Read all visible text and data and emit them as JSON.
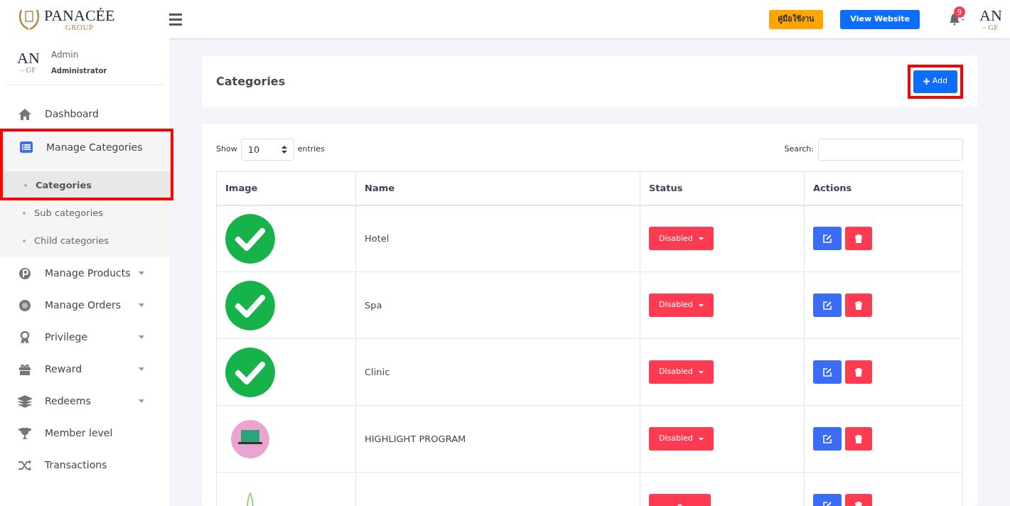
{
  "header": {
    "logo": {
      "name": "PANACÉE",
      "tagline": "GROUP"
    },
    "manual_button": "คู่มือใช้งาน",
    "website_button": "View Website",
    "notifications": "9",
    "avatar_text": "AN",
    "avatar_sub": "– GF"
  },
  "sidebar": {
    "user": {
      "avatar_text": "AN",
      "avatar_sub": "– GF",
      "name": "Admin",
      "role": "Administrator"
    },
    "items": [
      {
        "label": "Dashboard",
        "has_caret": false
      },
      {
        "label": "Manage Categories",
        "has_caret": true,
        "expanded": true,
        "annotated": true,
        "children": [
          {
            "label": "Categories",
            "selected": true
          },
          {
            "label": "Sub categories",
            "selected": false
          },
          {
            "label": "Child categories",
            "selected": false
          }
        ]
      },
      {
        "label": "Manage Products",
        "has_caret": true,
        "expanded": false
      },
      {
        "label": "Manage Orders",
        "has_caret": true,
        "expanded": false
      },
      {
        "label": "Privilege",
        "has_caret": true,
        "expanded": false
      },
      {
        "label": "Reward",
        "has_caret": true,
        "expanded": false
      },
      {
        "label": "Redeems",
        "has_caret": true,
        "expanded": false
      },
      {
        "label": "Member level",
        "has_caret": false
      },
      {
        "label": "Transactions",
        "has_caret": false
      }
    ]
  },
  "page": {
    "title": "Categories",
    "add_button": {
      "label": "Add",
      "annotated": true
    }
  },
  "table": {
    "show_label": "Show",
    "page_size": "10",
    "entries_label": "entries",
    "search_label": "Search:",
    "columns": [
      "Image",
      "Name",
      "Status",
      "Actions"
    ],
    "rows": [
      {
        "kind": "check",
        "name": "Hotel",
        "status": "Disabled"
      },
      {
        "kind": "check",
        "name": "Spa",
        "status": "Disabled"
      },
      {
        "kind": "check",
        "name": "Clinic",
        "status": "Disabled"
      },
      {
        "kind": "laptop",
        "name": "HIGHLIGHT PROGRAM",
        "status": "Disabled"
      },
      {
        "kind": "sprout"
      }
    ]
  }
}
